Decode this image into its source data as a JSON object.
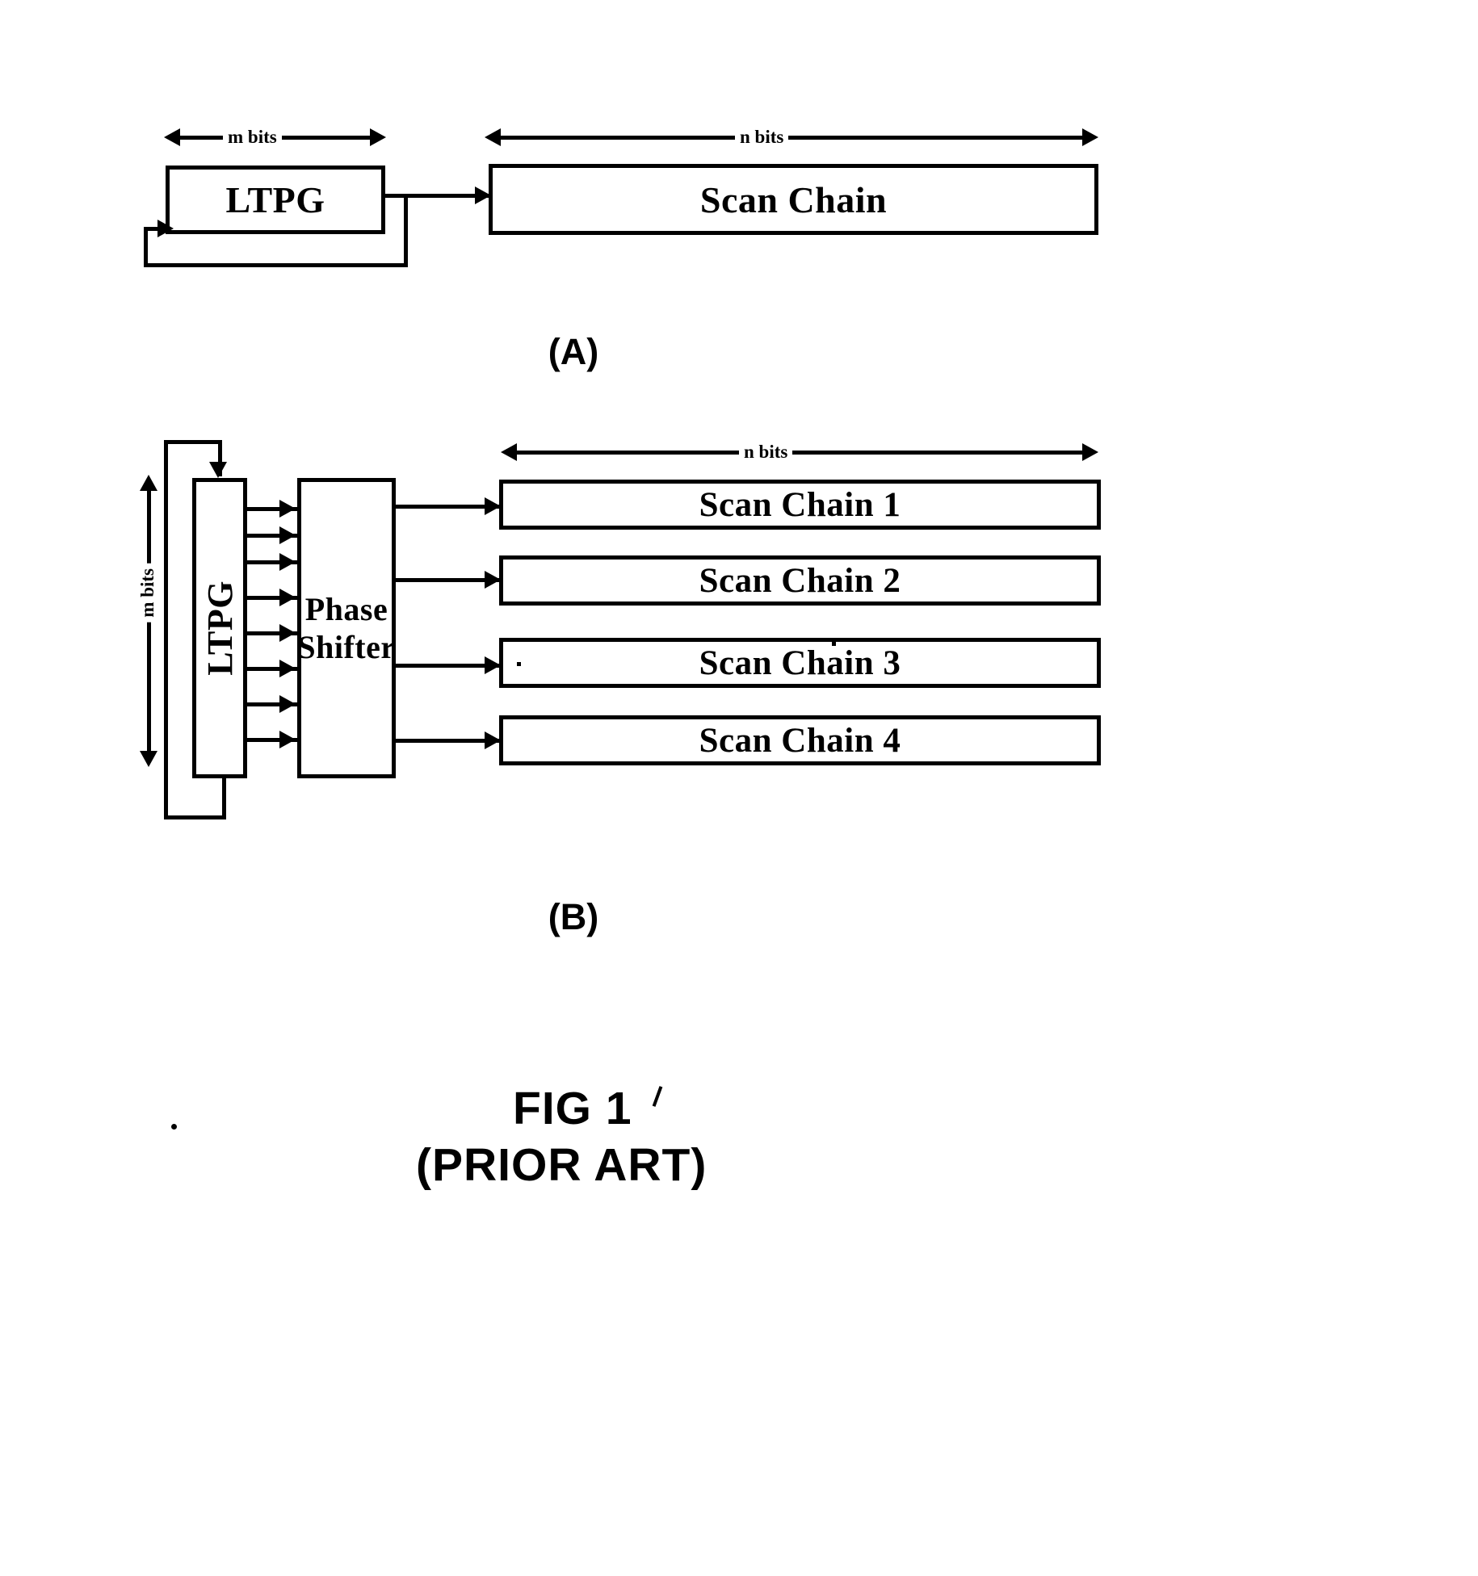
{
  "figure": {
    "title": "FIG 1",
    "subtitle": "(PRIOR ART)",
    "panel_a_caption": "(A)",
    "panel_b_caption": "(B)"
  },
  "panel_a": {
    "dimension_m": "m bits",
    "dimension_n": "n bits",
    "ltpg_label": "LTPG",
    "scan_chain_label": "Scan Chain"
  },
  "panel_b": {
    "dimension_m": "m bits",
    "dimension_n": "n bits",
    "ltpg_label": "LTPG",
    "phase_shifter_line1": "Phase",
    "phase_shifter_line2": "Shifter",
    "scan_chains": [
      {
        "label": "Scan Chain 1"
      },
      {
        "label": "Scan Chain 2"
      },
      {
        "label": "Scan Chain 3"
      },
      {
        "label": "Scan Chain 4"
      }
    ]
  },
  "colors": {
    "ink": "#000000",
    "paper": "#ffffff"
  }
}
